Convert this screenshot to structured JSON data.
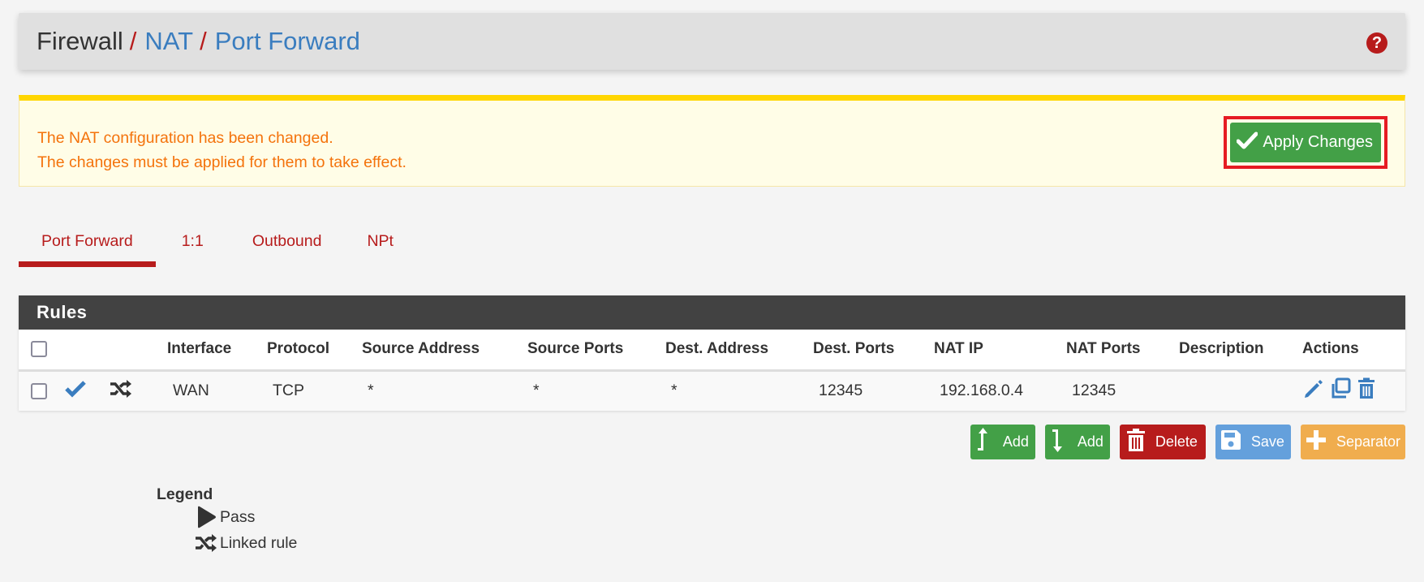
{
  "header": {
    "breadcrumb": {
      "root": "Firewall",
      "separator": "/",
      "items": [
        "NAT",
        "Port Forward"
      ]
    },
    "help_icon": "question-circle-icon"
  },
  "alert": {
    "line1": "The NAT configuration has been changed.",
    "line2": "The changes must be applied for them to take effect.",
    "apply_button": {
      "label": "Apply Changes",
      "icon": "check-icon"
    }
  },
  "tabs": [
    {
      "label": "Port Forward",
      "active": true
    },
    {
      "label": "1:1",
      "active": false
    },
    {
      "label": "Outbound",
      "active": false
    },
    {
      "label": "NPt",
      "active": false
    }
  ],
  "rules_panel": {
    "title": "Rules",
    "columns": [
      "",
      "",
      "",
      "Interface",
      "Protocol",
      "Source Address",
      "Source Ports",
      "Dest. Address",
      "Dest. Ports",
      "NAT IP",
      "NAT Ports",
      "Description",
      "Actions"
    ],
    "rows": [
      {
        "checked": false,
        "status_icon": "check-icon",
        "type_icon": "random-linked-icon",
        "interface": "WAN",
        "protocol": "TCP",
        "source_address": "*",
        "source_ports": "*",
        "dest_address": "*",
        "dest_ports": "12345",
        "nat_ip": "192.168.0.4",
        "nat_ports": "12345",
        "description": "",
        "actions": [
          "edit-pencil-icon",
          "copy-icon",
          "trash-icon"
        ]
      }
    ]
  },
  "buttons": {
    "add_top": "Add",
    "add_bottom": "Add",
    "delete": "Delete",
    "save": "Save",
    "separator": "Separator"
  },
  "legend": {
    "title": "Legend",
    "items": [
      {
        "icon": "play-icon",
        "label": "Pass"
      },
      {
        "icon": "random-linked-icon",
        "label": "Linked rule"
      }
    ]
  },
  "colors": {
    "brand_red": "#b71c1c",
    "link_blue": "#3a7dbf",
    "alert_orange": "#f4730c",
    "alert_bg": "#fffde7",
    "alert_border": "#ffd600",
    "success_green": "#43a047",
    "highlight_red": "#e61b23",
    "save_blue": "#64a0dc",
    "separator_orange": "#f0ad4e",
    "panel_dark": "#424242"
  }
}
